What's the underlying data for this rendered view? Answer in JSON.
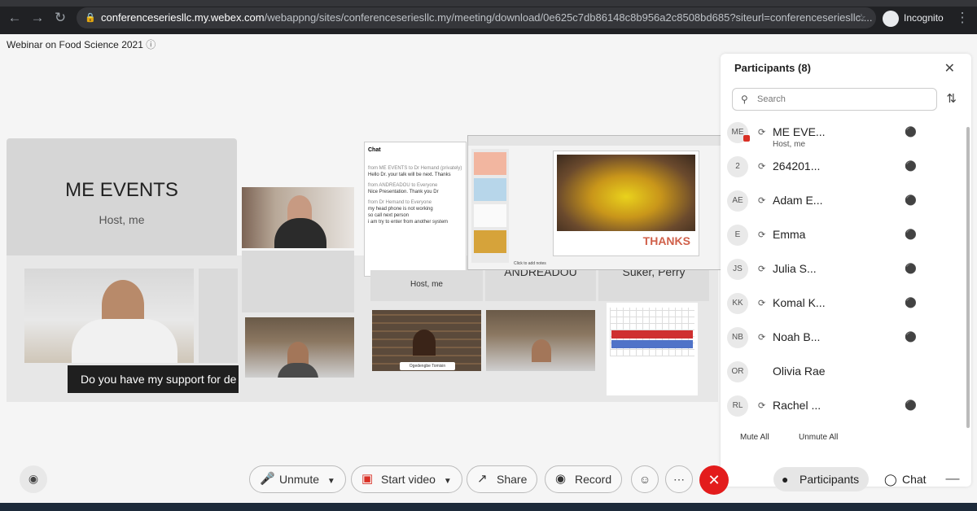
{
  "browser": {
    "url_host": "conferenceseriesllc.my.webex.com",
    "url_path": "/webappng/sites/conferenceseriesllc.my/meeting/download/0e625c7db86148c8b956a2c8508bd685?siteurl=conferenceseriesllc....",
    "incognito_label": "Incognito"
  },
  "meeting": {
    "title": "Webinar on Food Science 2021",
    "host_tile_name": "ME EVENTS",
    "host_tile_sub": "Host, me",
    "caption": "Do you have my support for de",
    "tile_labels": {
      "host_me": "Host, me",
      "andreadou": "ANDREADOU",
      "suker": "Suker, Perry",
      "ogedengbe": "Ogedengbe Tomisin"
    }
  },
  "chat_overlay": {
    "title": "Chat",
    "lines": [
      "from ME EVENTS to Dr Hemand (privately)",
      "Hello Dr. your talk will be next. Thanks",
      "from ANDREADOU to Everyone",
      "Nice Presentation. Thank you Dr",
      "from Dr Hemand to Everyone",
      "my head phone is not working",
      "so call next person",
      "i am try to enter from another system"
    ]
  },
  "slide": {
    "thanks_text": "THANKS",
    "notes_text": "Click to add notes"
  },
  "participants": {
    "title": "Participants (8)",
    "search_placeholder": "Search",
    "mute_all": "Mute All",
    "unmute_all": "Unmute All",
    "list": [
      {
        "initials": "ME",
        "name": "ME EVE...",
        "sub": "Host, me",
        "muted": true,
        "audio": true
      },
      {
        "initials": "2",
        "name": "264201...",
        "sub": "",
        "muted": true,
        "audio": true
      },
      {
        "initials": "AE",
        "name": "Adam E...",
        "sub": "",
        "muted": true,
        "audio": true
      },
      {
        "initials": "E",
        "name": "Emma",
        "sub": "",
        "muted": true,
        "audio": true
      },
      {
        "initials": "JS",
        "name": "Julia S...",
        "sub": "",
        "muted": true,
        "audio": true
      },
      {
        "initials": "KK",
        "name": "Komal K...",
        "sub": "",
        "muted": true,
        "audio": true
      },
      {
        "initials": "NB",
        "name": "Noah B...",
        "sub": "",
        "muted": true,
        "audio": true
      },
      {
        "initials": "OR",
        "name": "Olivia Rae",
        "sub": "",
        "muted": false,
        "audio": false
      },
      {
        "initials": "RL",
        "name": "Rachel ...",
        "sub": "",
        "muted": true,
        "audio": true
      }
    ]
  },
  "controls": {
    "unmute": "Unmute",
    "start_video": "Start video",
    "share": "Share",
    "record": "Record",
    "participants": "Participants",
    "chat": "Chat"
  },
  "colors": {
    "end_call": "#e31c1c",
    "muted_icon": "#e05050"
  }
}
